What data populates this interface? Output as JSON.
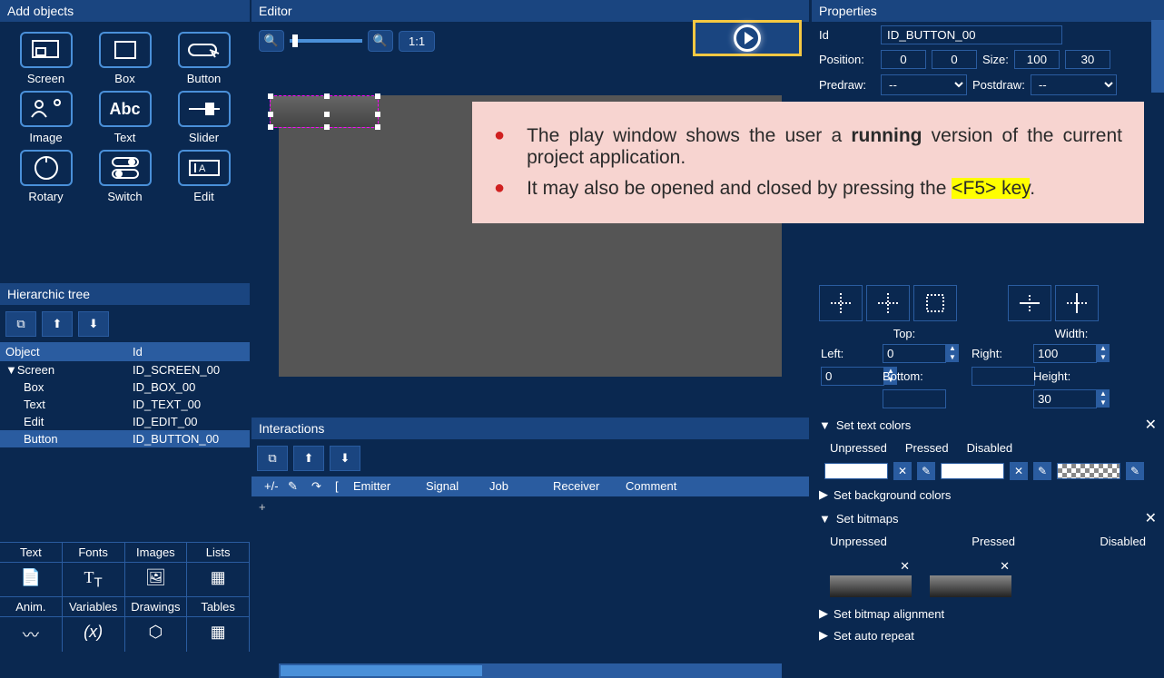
{
  "add_objects": {
    "title": "Add objects",
    "items": [
      {
        "label": "Screen"
      },
      {
        "label": "Box"
      },
      {
        "label": "Button"
      },
      {
        "label": "Image"
      },
      {
        "label": "Text"
      },
      {
        "label": "Slider"
      },
      {
        "label": "Rotary"
      },
      {
        "label": "Switch"
      },
      {
        "label": "Edit"
      }
    ]
  },
  "hier": {
    "title": "Hierarchic tree",
    "headers": {
      "obj": "Object",
      "id": "Id"
    },
    "rows": [
      {
        "obj": "Screen",
        "id": "ID_SCREEN_00",
        "root": true
      },
      {
        "obj": "Box",
        "id": "ID_BOX_00"
      },
      {
        "obj": "Text",
        "id": "ID_TEXT_00"
      },
      {
        "obj": "Edit",
        "id": "ID_EDIT_00"
      },
      {
        "obj": "Button",
        "id": "ID_BUTTON_00",
        "sel": true
      }
    ]
  },
  "bottom_tabs": {
    "r1": [
      "Text",
      "Fonts",
      "Images",
      "Lists"
    ],
    "r2": [
      "Anim.",
      "Variables",
      "Drawings",
      "Tables"
    ]
  },
  "editor": {
    "title": "Editor",
    "ratio": "1:1"
  },
  "interactions": {
    "title": "Interactions",
    "cols": [
      "+/-",
      "✎",
      "↷",
      "[",
      "Emitter",
      "Signal",
      "Job",
      "Receiver",
      "Comment"
    ],
    "add": "+"
  },
  "props": {
    "title": "Properties",
    "id_label": "Id",
    "id_value": "ID_BUTTON_00",
    "pos_label": "Position:",
    "pos_x": "0",
    "pos_y": "0",
    "size_label": "Size:",
    "size_w": "100",
    "size_h": "30",
    "predraw_label": "Predraw:",
    "predraw_val": "--",
    "postdraw_label": "Postdraw:",
    "postdraw_val": "--",
    "top": "Top:",
    "left": "Left:",
    "right": "Right:",
    "bottom": "Bottom:",
    "width": "Width:",
    "height": "Height:",
    "top_v": "0",
    "left_v": "0",
    "right_v": "",
    "bottom_v": "",
    "width_v": "100",
    "height_v": "30",
    "set_text_colors": "Set text colors",
    "unpressed": "Unpressed",
    "pressed": "Pressed",
    "disabled": "Disabled",
    "set_bg_colors": "Set background colors",
    "set_bitmaps": "Set bitmaps",
    "set_bitmap_align": "Set bitmap alignment",
    "set_auto_repeat": "Set auto repeat"
  },
  "callout": {
    "line1a": "The play window shows the user a ",
    "line1b": "running",
    "line1c": " version of the current project application.",
    "line2a": "It may also be opened and closed by pressing the ",
    "line2b": "<F5> key",
    "line2c": "."
  }
}
